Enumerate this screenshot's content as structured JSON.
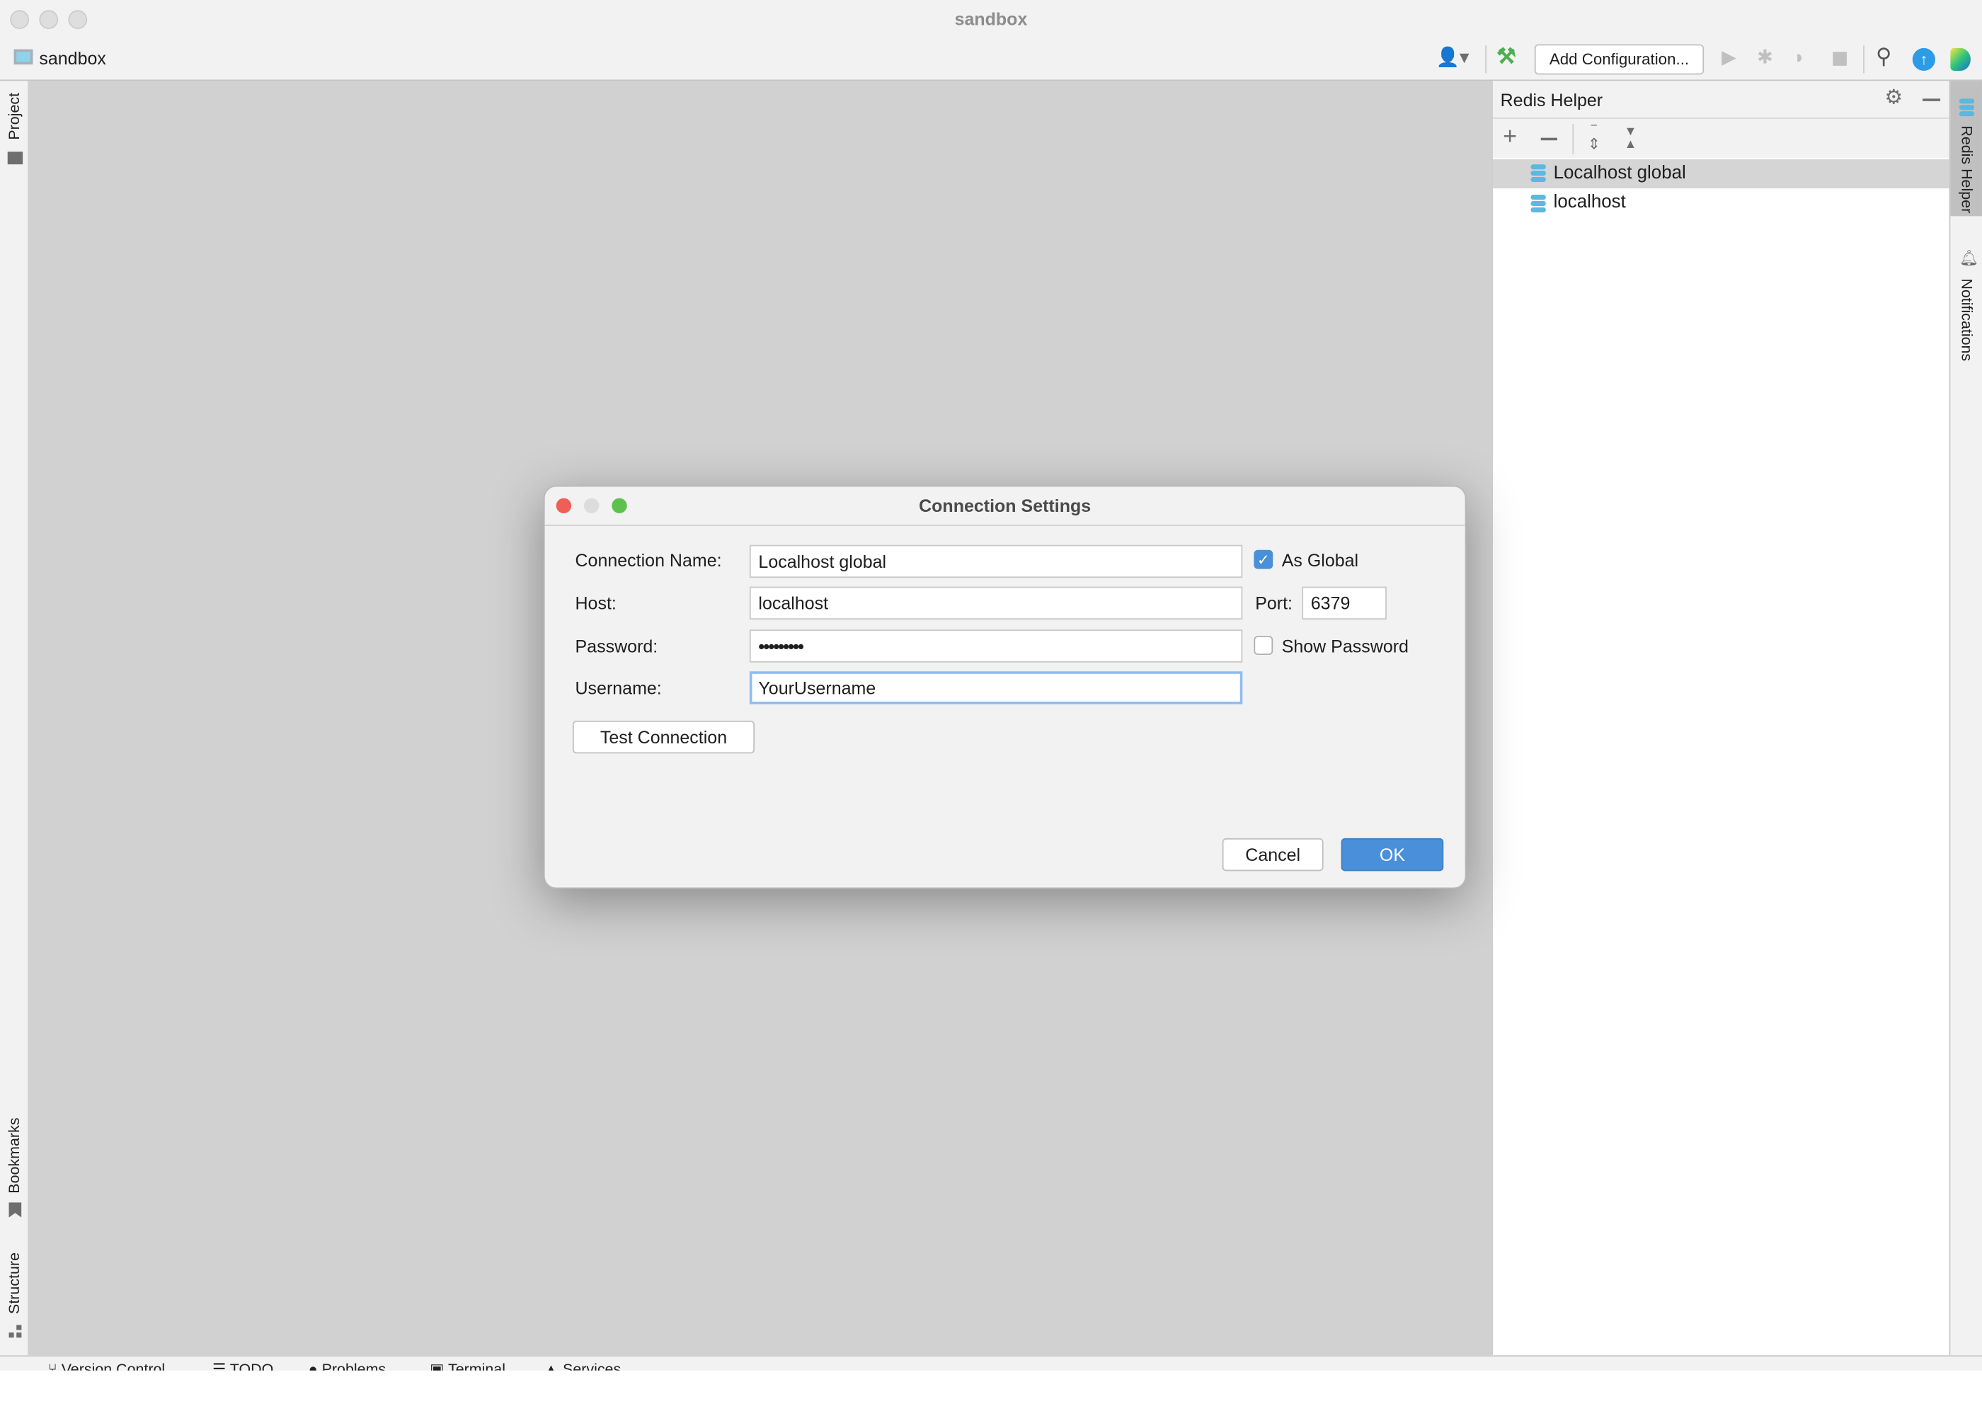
{
  "window": {
    "title": "sandbox"
  },
  "toolbar": {
    "project_name": "sandbox",
    "add_configuration": "Add Configuration...",
    "icons": [
      "user-icon",
      "hammer-icon",
      "run-icon",
      "debug-icon",
      "coverage-icon",
      "stop-icon",
      "search-icon",
      "update-icon",
      "toolbox-icon"
    ]
  },
  "left_strip": {
    "project": "Project",
    "bookmarks": "Bookmarks",
    "structure": "Structure"
  },
  "right_strip": {
    "redis_helper": "Redis Helper",
    "notifications": "Notifications"
  },
  "redis_panel": {
    "title": "Redis Helper",
    "connections": [
      {
        "label": "Localhost global",
        "selected": true
      },
      {
        "label": "localhost",
        "selected": false
      }
    ],
    "db_icon_color": "#5bb8e0"
  },
  "bottom_bar": {
    "items": [
      "Version Control",
      "TODO",
      "Problems",
      "Terminal",
      "Services"
    ]
  },
  "dialog": {
    "title": "Connection Settings",
    "connection_name_label": "Connection Name:",
    "connection_name": "Localhost global",
    "as_global_label": "As Global",
    "as_global": true,
    "host_label": "Host:",
    "host": "localhost",
    "port_label": "Port:",
    "port": "6379",
    "password_label": "Password:",
    "password_masked": "•••••••••",
    "show_password_label": "Show Password",
    "show_password": false,
    "username_label": "Username:",
    "username": "YourUsername",
    "test_connection": "Test Connection",
    "cancel": "Cancel",
    "ok": "OK",
    "accent": "#4a8fd9"
  }
}
